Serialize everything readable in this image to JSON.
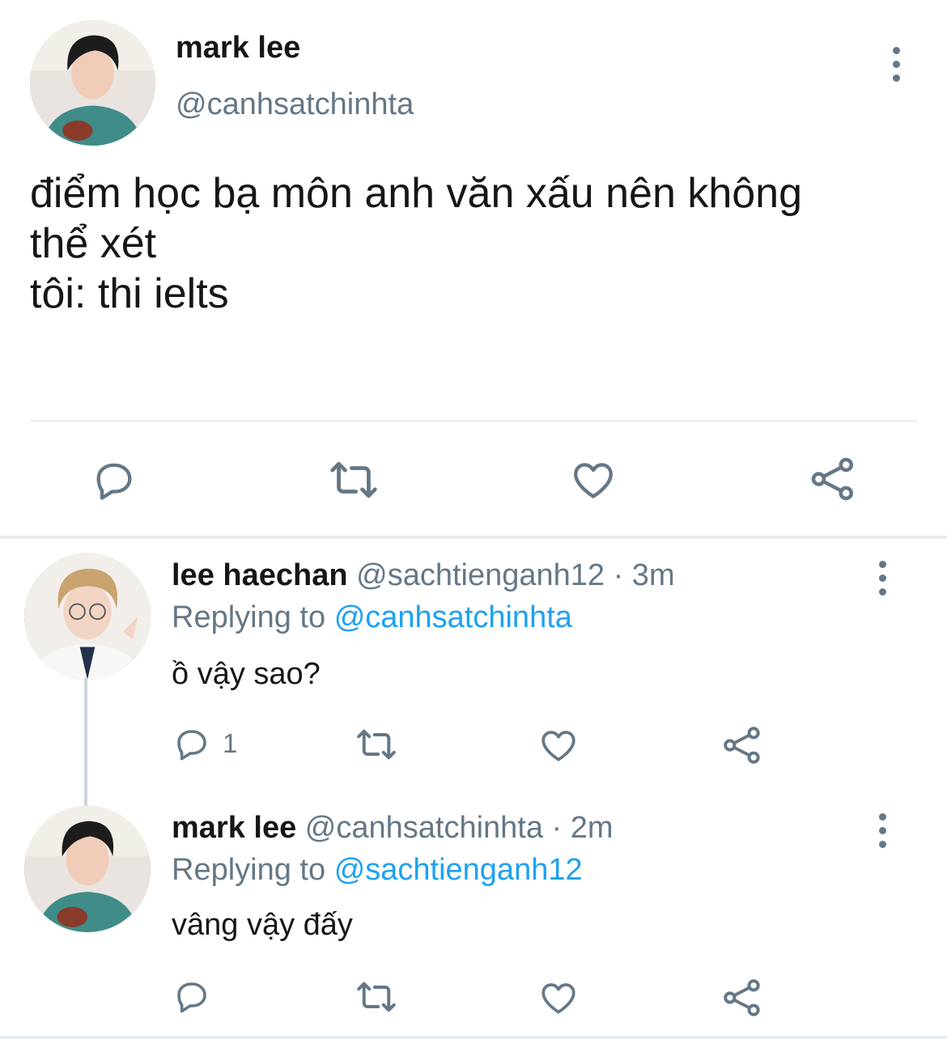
{
  "main_tweet": {
    "author_name": "mark lee",
    "author_handle": "@canhsatchinhta",
    "text_lines": [
      "điểm học bạ môn anh văn xấu nên không",
      "thể xét",
      "tôi: thi ielts"
    ],
    "avatar_icon": "avatar-photo"
  },
  "replies": [
    {
      "author_name": "lee haechan",
      "handle_time": "@sachtienganh12 · 3m",
      "replying_prefix": "Replying to",
      "replying_to": "@canhsatchinhta",
      "text": "ồ vậy sao?",
      "reply_count": "1"
    },
    {
      "author_name": "mark lee",
      "handle_time": "@canhsatchinhta · 2m",
      "replying_prefix": "Replying to",
      "replying_to": "@sachtienganh12",
      "text": "vâng vậy đấy",
      "reply_count": ""
    }
  ],
  "icons": [
    "reply-icon",
    "retweet-icon",
    "like-icon",
    "share-icon",
    "more-icon"
  ],
  "colors": {
    "text": "#14171a",
    "secondary": "#657786",
    "link": "#1da1f2",
    "divider": "#e6ecf0",
    "thread_line": "#ccd6dd"
  }
}
